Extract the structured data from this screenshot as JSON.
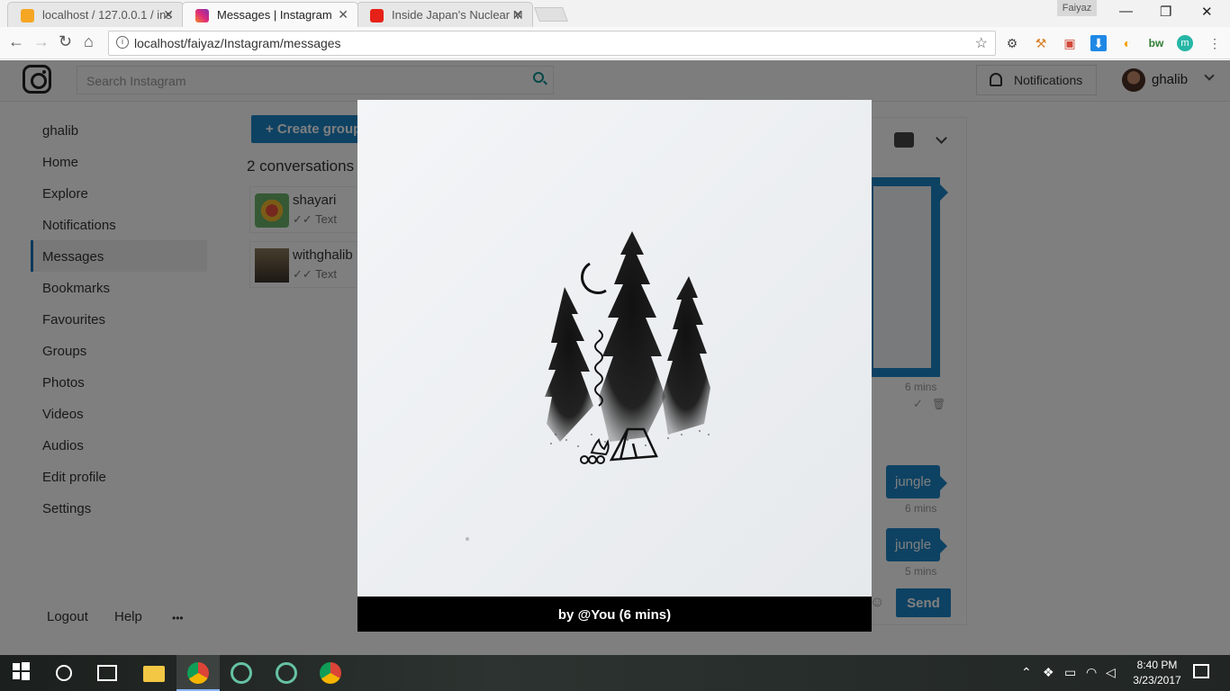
{
  "browser": {
    "tabs": [
      {
        "title": "localhost / 127.0.0.1 / ins",
        "favicon": "pma-icon"
      },
      {
        "title": "Messages | Instagram",
        "favicon": "instagram-icon"
      },
      {
        "title": "Inside Japan's Nuclear M",
        "favicon": "youtube-icon"
      }
    ],
    "window_user": "Faiyaz",
    "url": "localhost/faiyaz/Instagram/messages"
  },
  "header": {
    "search_placeholder": "Search Instagram",
    "notifications_label": "Notifications",
    "username": "ghalib"
  },
  "sidebar": {
    "items": [
      "ghalib",
      "Home",
      "Explore",
      "Notifications",
      "Messages",
      "Bookmarks",
      "Favourites",
      "Groups",
      "Photos",
      "Videos",
      "Audios",
      "Edit profile",
      "Settings"
    ],
    "active": "Messages",
    "footer": {
      "logout": "Logout",
      "help": "Help",
      "more": "•••"
    }
  },
  "conversations": {
    "create_group_label": "+ Create group",
    "count_label": "2 conversations",
    "items": [
      {
        "name": "shayari",
        "preview": "Text"
      },
      {
        "name": "withghalib",
        "preview": "Text"
      }
    ]
  },
  "chat": {
    "messages": [
      {
        "text": "jungle",
        "time": "6 mins"
      },
      {
        "text": "jungle",
        "time": "5 mins"
      }
    ],
    "image_time": "6 mins",
    "send_label": "Send"
  },
  "modal": {
    "caption": "by @You (6 mins)"
  },
  "taskbar": {
    "time": "8:40 PM",
    "date": "3/23/2017"
  },
  "colors": {
    "accent": "#1c84c6",
    "overlay": "rgba(0,0,0,0.5)"
  }
}
